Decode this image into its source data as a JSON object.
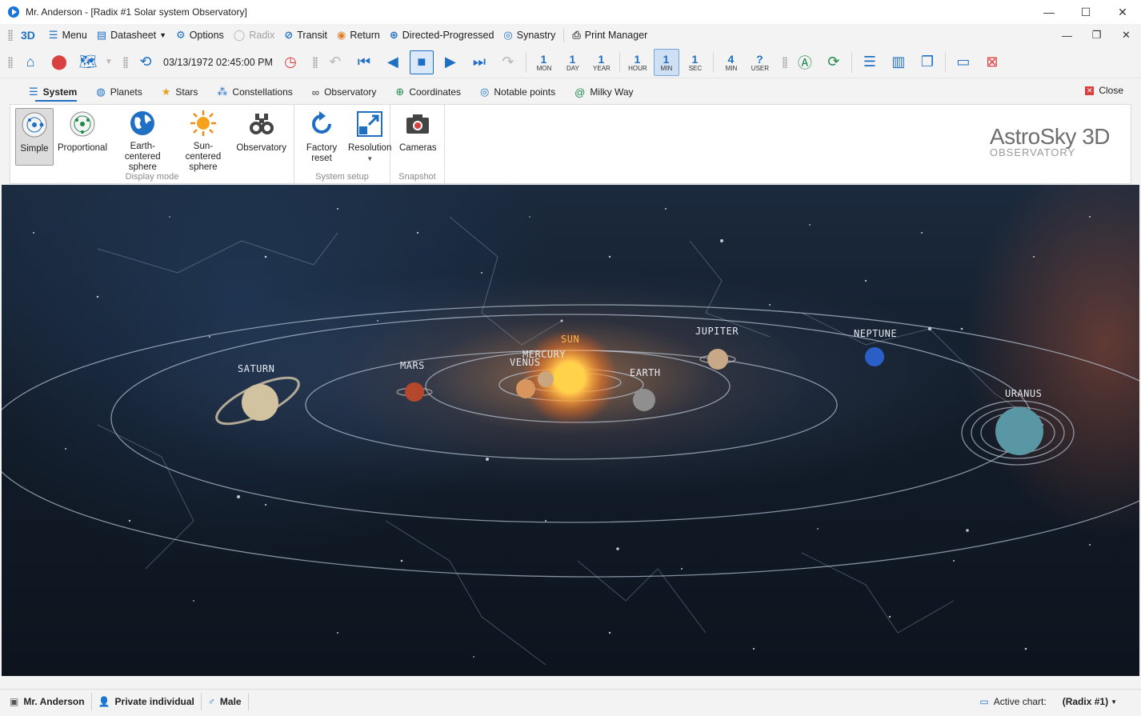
{
  "window": {
    "title": "Mr. Anderson - [Radix #1 Solar system Observatory]",
    "controls": {
      "minimize": "—",
      "maximize": "☐",
      "close": "✕"
    }
  },
  "menubar": {
    "logo": "3D",
    "items": [
      {
        "label": "Menu",
        "icon": "hamburger-icon",
        "enabled": true
      },
      {
        "label": "Datasheet",
        "icon": "datasheet-icon",
        "enabled": true,
        "dropdown": true
      },
      {
        "label": "Options",
        "icon": "gear-icon",
        "enabled": true
      },
      {
        "label": "Radix",
        "icon": "radix-icon",
        "enabled": false
      },
      {
        "label": "Transit",
        "icon": "transit-icon",
        "enabled": true
      },
      {
        "label": "Return",
        "icon": "return-icon",
        "enabled": true
      },
      {
        "label": "Directed-Progressed",
        "icon": "directed-icon",
        "enabled": true
      },
      {
        "label": "Synastry",
        "icon": "synastry-icon",
        "enabled": true
      },
      {
        "label": "Print Manager",
        "icon": "printer-icon",
        "enabled": true
      }
    ]
  },
  "toolbar": {
    "datetime": "03/13/1972 02:45:00 PM",
    "steps": [
      {
        "num": "1",
        "label": "MON"
      },
      {
        "num": "1",
        "label": "DAY"
      },
      {
        "num": "1",
        "label": "YEAR"
      },
      {
        "num": "1",
        "label": "HOUR"
      },
      {
        "num": "1",
        "label": "MIN",
        "active": true
      },
      {
        "num": "1",
        "label": "SEC"
      },
      {
        "num": "4",
        "label": "MIN"
      },
      {
        "num": "?",
        "label": "USER"
      }
    ]
  },
  "ribbon_tabs": [
    {
      "label": "System",
      "icon": "list-icon",
      "active": true
    },
    {
      "label": "Planets",
      "icon": "globe-icon"
    },
    {
      "label": "Stars",
      "icon": "star-icon"
    },
    {
      "label": "Constellations",
      "icon": "constellation-icon"
    },
    {
      "label": "Observatory",
      "icon": "binoculars-icon"
    },
    {
      "label": "Coordinates",
      "icon": "coordinates-icon"
    },
    {
      "label": "Notable points",
      "icon": "target-icon"
    },
    {
      "label": "Milky Way",
      "icon": "galaxy-icon"
    }
  ],
  "close_label": "Close",
  "ribbon": {
    "display_mode": {
      "label": "Display mode",
      "buttons": [
        {
          "label": "Simple",
          "active": true
        },
        {
          "label": "Proportional"
        },
        {
          "label": "Earth-centered sphere"
        },
        {
          "label": "Sun-centered sphere"
        },
        {
          "label": "Observatory"
        }
      ]
    },
    "system_setup": {
      "label": "System setup",
      "buttons": [
        {
          "label": "Factory reset"
        },
        {
          "label": "Resolution"
        }
      ]
    },
    "snapshot": {
      "label": "Snapshot",
      "buttons": [
        {
          "label": "Cameras"
        }
      ]
    },
    "logo": {
      "line1": "AstroSky 3D",
      "line2": "OBSERVATORY"
    }
  },
  "planets": [
    {
      "name": "SUN",
      "color": "#ffd24a"
    },
    {
      "name": "MERCURY",
      "color": "#c9a67e"
    },
    {
      "name": "VENUS",
      "color": "#d9955e"
    },
    {
      "name": "MARS",
      "color": "#b5482c"
    },
    {
      "name": "EARTH",
      "color": "#8f8f8f"
    },
    {
      "name": "JUPITER",
      "color": "#c7a888"
    },
    {
      "name": "SATURN",
      "color": "#d2c3a0"
    },
    {
      "name": "NEPTUNE",
      "color": "#2a5fc7"
    },
    {
      "name": "URANUS",
      "color": "#5a97a5"
    }
  ],
  "statusbar": {
    "user": "Mr. Anderson",
    "type": "Private individual",
    "gender": "Male",
    "active_chart_label": "Active chart:",
    "active_chart_value": "(Radix #1)"
  }
}
